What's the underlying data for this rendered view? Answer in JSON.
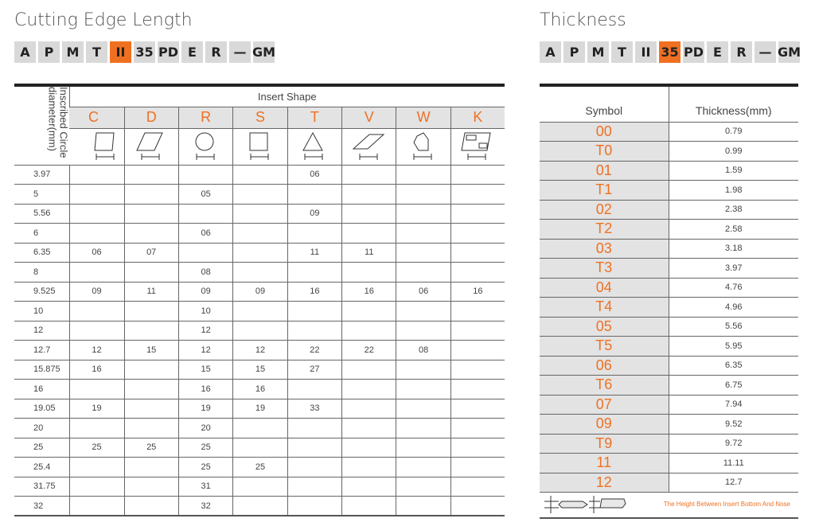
{
  "left": {
    "title": "Cutting Edge Length",
    "codes": [
      "A",
      "P",
      "M",
      "T",
      "II",
      "35",
      "PD",
      "E",
      "R",
      "—",
      "GM"
    ],
    "highlight_index": 4,
    "row_header": "Inscribed Circle diameter(mm)",
    "group_header": "Insert Shape",
    "shapes": [
      "C",
      "D",
      "R",
      "S",
      "T",
      "V",
      "W",
      "K"
    ],
    "rows": [
      [
        "3.97",
        "",
        "",
        "",
        "",
        "06",
        "",
        "",
        ""
      ],
      [
        "5",
        "",
        "",
        "05",
        "",
        "",
        "",
        "",
        ""
      ],
      [
        "5.56",
        "",
        "",
        "",
        "",
        "09",
        "",
        "",
        ""
      ],
      [
        "6",
        "",
        "",
        "06",
        "",
        "",
        "",
        "",
        ""
      ],
      [
        "6.35",
        "06",
        "07",
        "",
        "",
        "11",
        "11",
        "",
        ""
      ],
      [
        "8",
        "",
        "",
        "08",
        "",
        "",
        "",
        "",
        ""
      ],
      [
        "9.525",
        "09",
        "11",
        "09",
        "09",
        "16",
        "16",
        "06",
        "16"
      ],
      [
        "10",
        "",
        "",
        "10",
        "",
        "",
        "",
        "",
        ""
      ],
      [
        "12",
        "",
        "",
        "12",
        "",
        "",
        "",
        "",
        ""
      ],
      [
        "12.7",
        "12",
        "15",
        "12",
        "12",
        "22",
        "22",
        "08",
        ""
      ],
      [
        "15.875",
        "16",
        "",
        "15",
        "15",
        "27",
        "",
        "",
        ""
      ],
      [
        "16",
        "",
        "",
        "16",
        "16",
        "",
        "",
        "",
        ""
      ],
      [
        "19.05",
        "19",
        "",
        "19",
        "19",
        "33",
        "",
        "",
        ""
      ],
      [
        "20",
        "",
        "",
        "20",
        "",
        "",
        "",
        "",
        ""
      ],
      [
        "25",
        "25",
        "25",
        "25",
        "",
        "",
        "",
        "",
        ""
      ],
      [
        "25.4",
        "",
        "",
        "25",
        "25",
        "",
        "",
        "",
        ""
      ],
      [
        "31.75",
        "",
        "",
        "31",
        "",
        "",
        "",
        "",
        ""
      ],
      [
        "32",
        "",
        "",
        "32",
        "",
        "",
        "",
        "",
        ""
      ]
    ]
  },
  "right": {
    "title": "Thickness",
    "codes": [
      "A",
      "P",
      "M",
      "T",
      "II",
      "35",
      "PD",
      "E",
      "R",
      "—",
      "GM"
    ],
    "highlight_index": 5,
    "headers": [
      "Symbol",
      "Thickness(mm)"
    ],
    "rows": [
      [
        "00",
        "0.79"
      ],
      [
        "T0",
        "0.99"
      ],
      [
        "01",
        "1.59"
      ],
      [
        "T1",
        "1.98"
      ],
      [
        "02",
        "2.38"
      ],
      [
        "T2",
        "2.58"
      ],
      [
        "03",
        "3.18"
      ],
      [
        "T3",
        "3.97"
      ],
      [
        "04",
        "4.76"
      ],
      [
        "T4",
        "4.96"
      ],
      [
        "05",
        "5.56"
      ],
      [
        "T5",
        "5.95"
      ],
      [
        "06",
        "6.35"
      ],
      [
        "T6",
        "6.75"
      ],
      [
        "07",
        "7.94"
      ],
      [
        "09",
        "9.52"
      ],
      [
        "T9",
        "9.72"
      ],
      [
        "11",
        "11.11"
      ],
      [
        "12",
        "12.7"
      ]
    ],
    "footnote": "The Height Between Insert Bottom And Nose"
  },
  "colors": {
    "accent": "#f07022",
    "cell_gray": "#e3e3e3"
  }
}
